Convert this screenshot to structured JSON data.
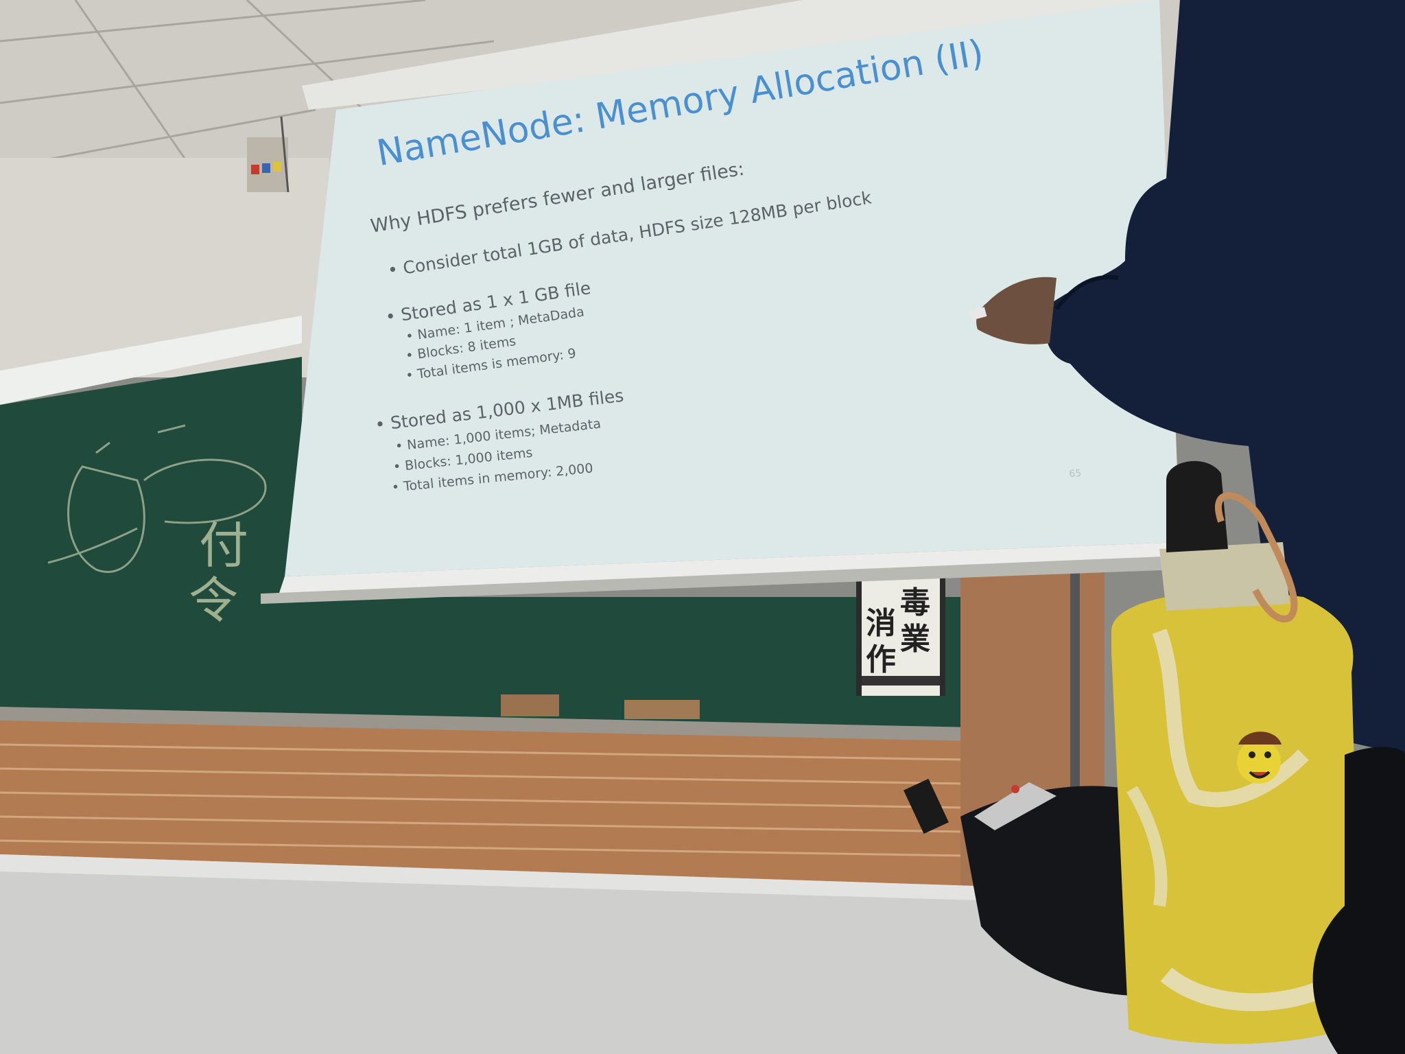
{
  "slide": {
    "title": "NameNode: Memory Allocation (II)",
    "subtitle": "Why HDFS prefers fewer and larger files:",
    "bullet_1": "• Consider total 1GB of data, HDFS size 128MB per block",
    "bullet_2": "• Stored as 1 x 1 GB file",
    "bullet_2_sub_1": "• Name: 1 item ; MetaDada",
    "bullet_2_sub_2": "• Blocks: 8 items",
    "bullet_2_sub_3": "• Total items is memory: 9",
    "bullet_3": "• Stored as 1,000 x 1MB files",
    "bullet_3_sub_1": "• Name: 1,000 items; Metadata",
    "bullet_3_sub_2": "• Blocks: 1,000 items",
    "bullet_3_sub_3": "• Total items in memory: 2,000",
    "page_number": "65"
  },
  "poster": {
    "char_1": "消",
    "char_2": "毒",
    "char_3": "作",
    "char_4": "業"
  },
  "chalk": {
    "char_1": "付",
    "char_2": "令"
  },
  "colors": {
    "screen": "#dde9e8",
    "title_blue": "#4a8fd0",
    "chalkboard": "#1e4a3a",
    "brick": "#b07850",
    "bottle_yellow": "#d8c23a",
    "jacket_navy": "#14203a"
  }
}
